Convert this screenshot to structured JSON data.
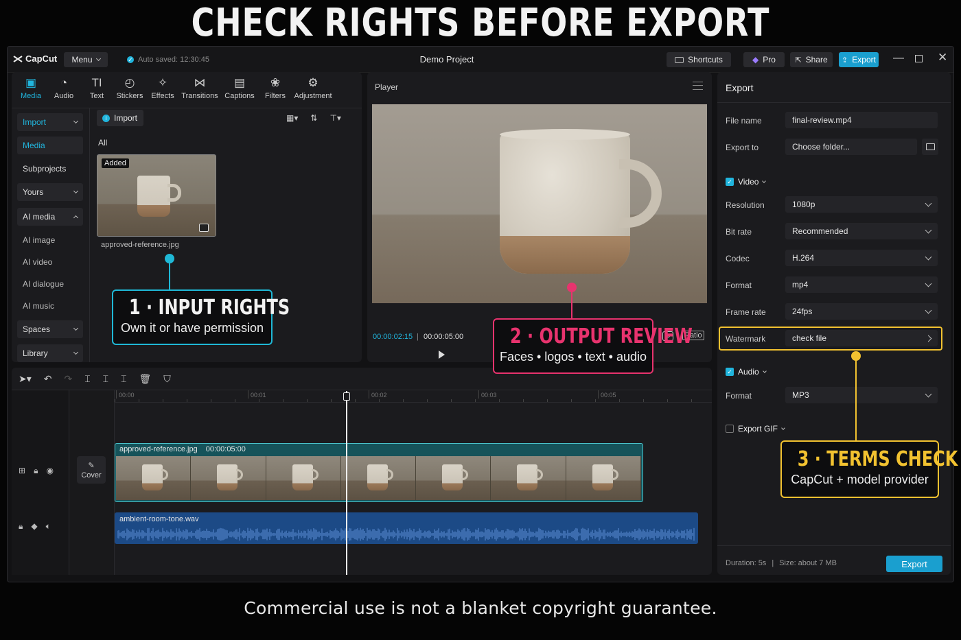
{
  "headline": "CHECK RIGHTS BEFORE EXPORT",
  "footer": "Commercial use is not a blanket copyright guarantee.",
  "titlebar": {
    "logo": "CapCut",
    "menu": "Menu",
    "autosave": "Auto saved: 12:30:45",
    "project": "Demo Project",
    "shortcuts": "Shortcuts",
    "pro": "Pro",
    "share": "Share",
    "export": "Export"
  },
  "toolbar": [
    {
      "label": "Media",
      "icon": "media-icon"
    },
    {
      "label": "Audio",
      "icon": "audio-icon"
    },
    {
      "label": "Text",
      "icon": "text-icon"
    },
    {
      "label": "Stickers",
      "icon": "stickers-icon"
    },
    {
      "label": "Effects",
      "icon": "effects-icon"
    },
    {
      "label": "Transitions",
      "icon": "transitions-icon"
    },
    {
      "label": "Captions",
      "icon": "captions-icon"
    },
    {
      "label": "Filters",
      "icon": "filters-icon"
    },
    {
      "label": "Adjustment",
      "icon": "adjustment-icon"
    }
  ],
  "sidebar": [
    {
      "label": "Import"
    },
    {
      "label": "Media"
    },
    {
      "label": "Subprojects"
    },
    {
      "label": "Yours"
    },
    {
      "label": "AI media"
    },
    {
      "label": "AI image"
    },
    {
      "label": "AI video"
    },
    {
      "label": "AI dialogue"
    },
    {
      "label": "AI music"
    },
    {
      "label": "Spaces"
    },
    {
      "label": "Library"
    }
  ],
  "media": {
    "import_button": "Import",
    "filter_all": "All",
    "badge": "Added",
    "filename": "approved-reference.jpg"
  },
  "player": {
    "title": "Player",
    "current_time": "00:00:02:15",
    "total_time": "00:00:05:00",
    "ratio": "Ratio"
  },
  "export": {
    "title": "Export",
    "file_name_label": "File name",
    "file_name_value": "final-review.mp4",
    "export_to_label": "Export to",
    "export_to_value": "Choose folder...",
    "video_label": "Video",
    "resolution_label": "Resolution",
    "resolution_value": "1080p",
    "bitrate_label": "Bit rate",
    "bitrate_value": "Recommended",
    "codec_label": "Codec",
    "codec_value": "H.264",
    "format_label": "Format",
    "format_value": "mp4",
    "framerate_label": "Frame rate",
    "framerate_value": "24fps",
    "watermark_label": "Watermark",
    "watermark_value": "check file",
    "audio_label": "Audio",
    "audio_format_label": "Format",
    "audio_format_value": "MP3",
    "gif_label": "Export GIF",
    "duration": "Duration: 5s",
    "size": "Size: about 7 MB",
    "export_button": "Export"
  },
  "timeline": {
    "ticks": [
      "00:00",
      "00:01",
      "00:02",
      "00:03",
      "00:05"
    ],
    "cover_label": "Cover",
    "video_clip_name": "approved-reference.jpg",
    "video_clip_duration": "00:00:05:00",
    "audio_clip_name": "ambient-room-tone.wav"
  },
  "callouts": {
    "c1_title": "1 · INPUT RIGHTS",
    "c1_sub": "Own it or have permission",
    "c2_title": "2 · OUTPUT REVIEW",
    "c2_sub": "Faces • logos • text • audio",
    "c3_title": "3 · TERMS CHECK",
    "c3_sub": "CapCut + model provider"
  },
  "colors": {
    "accent_blue": "#21b5dd",
    "cyan": "#1fb8d6",
    "pink": "#e8336e",
    "yellow": "#f2c230"
  }
}
